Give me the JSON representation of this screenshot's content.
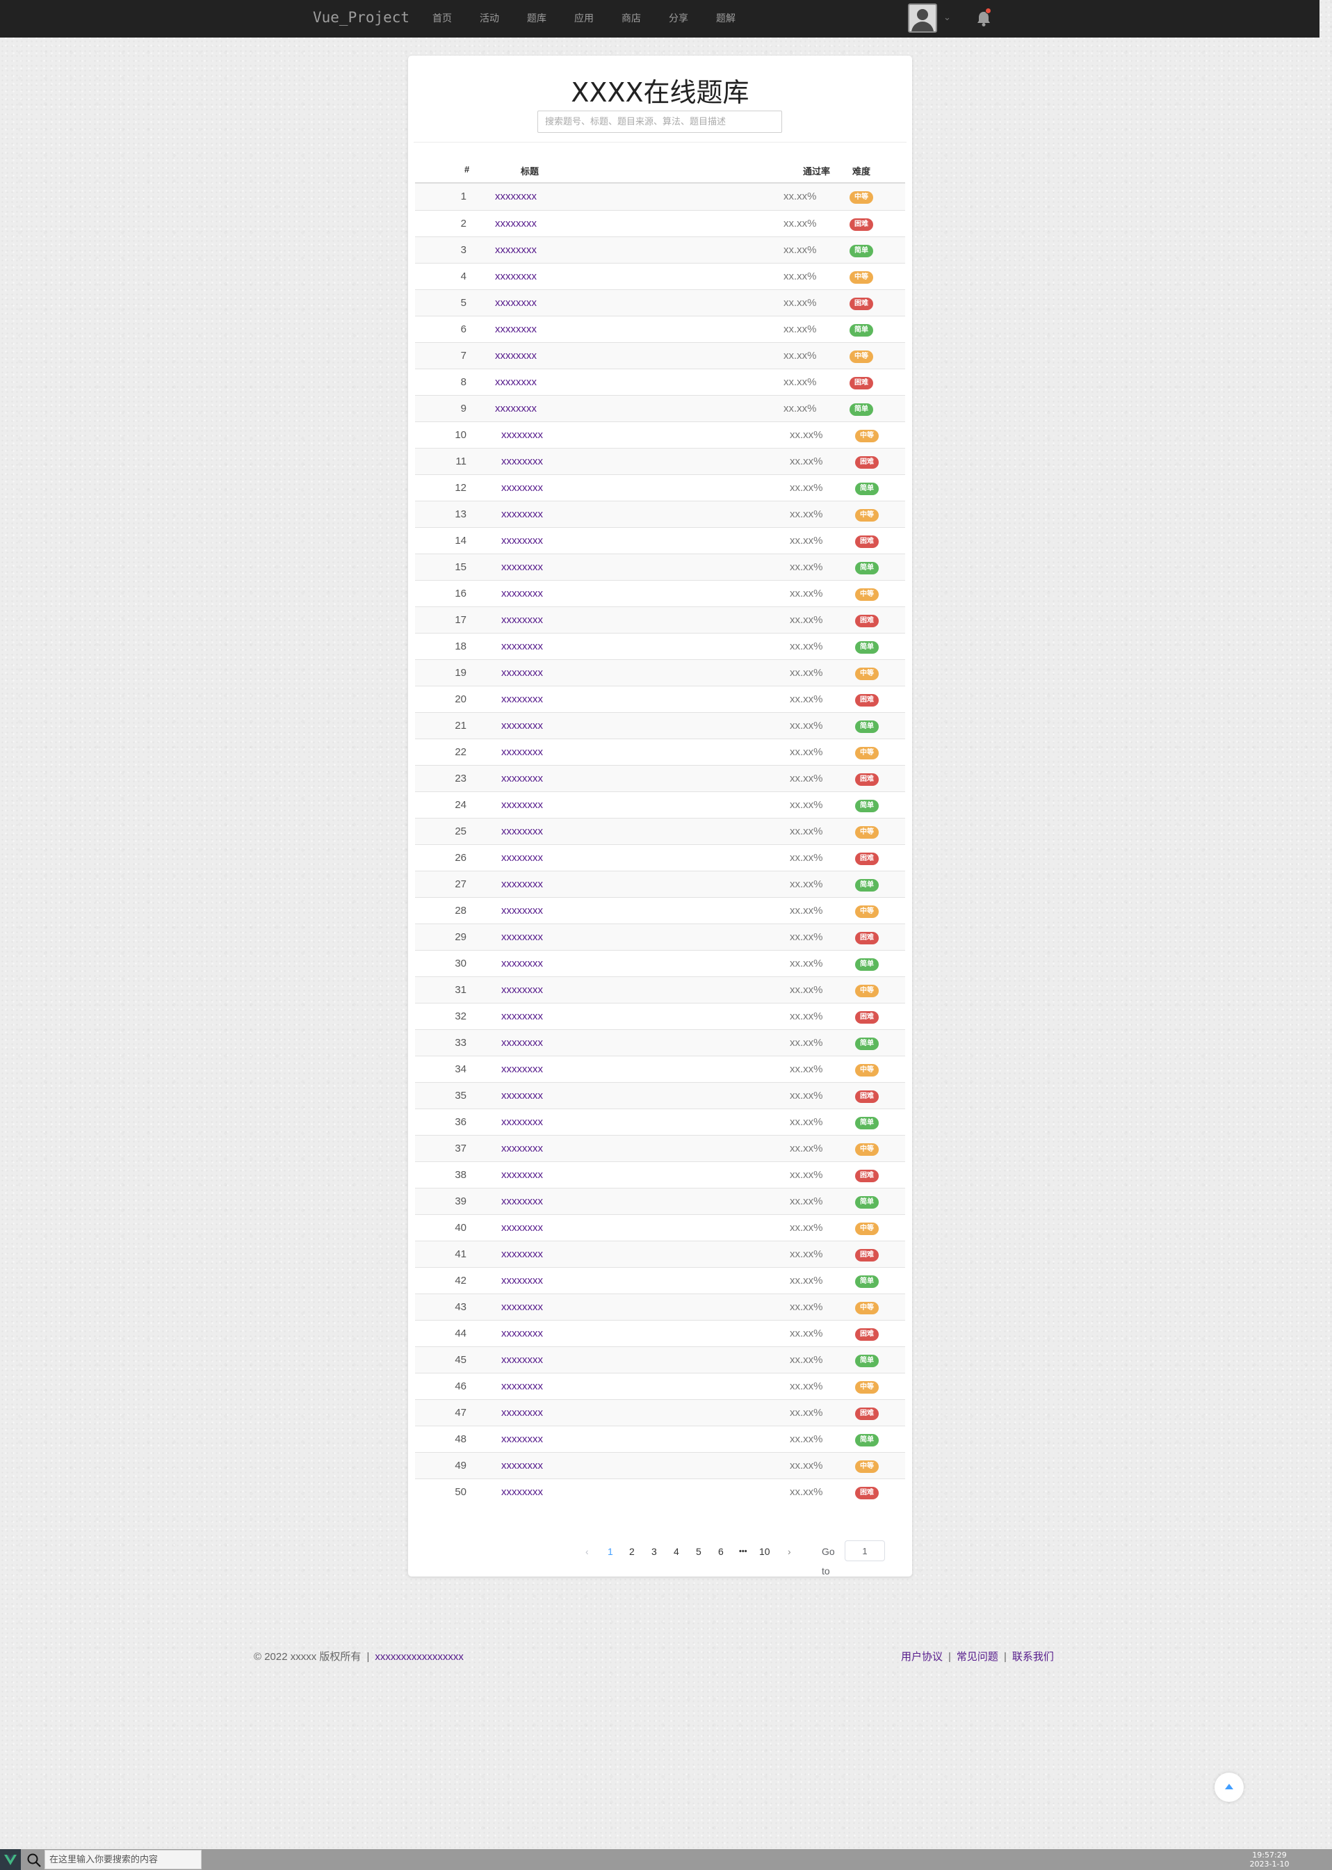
{
  "navbar": {
    "brand": "Vue_Project",
    "links": [
      "首页",
      "活动",
      "题库",
      "应用",
      "商店",
      "分享",
      "题解"
    ],
    "avatar_icon": "user-avatar-icon",
    "notification_icon": "bell-icon",
    "notification_dot_color": "#e9503f"
  },
  "main": {
    "title": "XXXX在线题库",
    "search_placeholder": "搜索题号、标题、题目来源、算法、题目描述",
    "columns": [
      "#",
      "标题",
      "通过率",
      "难度"
    ],
    "difficulty_labels": {
      "easy": "简单",
      "medium": "中等",
      "hard": "困难"
    },
    "difficulty_colors": {
      "easy": "#5cb85c",
      "medium": "#f0ad4e",
      "hard": "#d9534f"
    },
    "problems": [
      {
        "id": "1",
        "title": "xxxxxxxx",
        "rate": "xx.xx%",
        "difficulty": "medium"
      },
      {
        "id": "2",
        "title": "xxxxxxxx",
        "rate": "xx.xx%",
        "difficulty": "hard"
      },
      {
        "id": "3",
        "title": "xxxxxxxx",
        "rate": "xx.xx%",
        "difficulty": "easy"
      },
      {
        "id": "4",
        "title": "xxxxxxxx",
        "rate": "xx.xx%",
        "difficulty": "medium"
      },
      {
        "id": "5",
        "title": "xxxxxxxx",
        "rate": "xx.xx%",
        "difficulty": "hard"
      },
      {
        "id": "6",
        "title": "xxxxxxxx",
        "rate": "xx.xx%",
        "difficulty": "easy"
      },
      {
        "id": "7",
        "title": "xxxxxxxx",
        "rate": "xx.xx%",
        "difficulty": "medium"
      },
      {
        "id": "8",
        "title": "xxxxxxxx",
        "rate": "xx.xx%",
        "difficulty": "hard"
      },
      {
        "id": "9",
        "title": "xxxxxxxx",
        "rate": "xx.xx%",
        "difficulty": "easy"
      },
      {
        "id": "10",
        "title": "xxxxxxxx",
        "rate": "xx.xx%",
        "difficulty": "medium"
      },
      {
        "id": "11",
        "title": "xxxxxxxx",
        "rate": "xx.xx%",
        "difficulty": "hard"
      },
      {
        "id": "12",
        "title": "xxxxxxxx",
        "rate": "xx.xx%",
        "difficulty": "easy"
      },
      {
        "id": "13",
        "title": "xxxxxxxx",
        "rate": "xx.xx%",
        "difficulty": "medium"
      },
      {
        "id": "14",
        "title": "xxxxxxxx",
        "rate": "xx.xx%",
        "difficulty": "hard"
      },
      {
        "id": "15",
        "title": "xxxxxxxx",
        "rate": "xx.xx%",
        "difficulty": "easy"
      },
      {
        "id": "16",
        "title": "xxxxxxxx",
        "rate": "xx.xx%",
        "difficulty": "medium"
      },
      {
        "id": "17",
        "title": "xxxxxxxx",
        "rate": "xx.xx%",
        "difficulty": "hard"
      },
      {
        "id": "18",
        "title": "xxxxxxxx",
        "rate": "xx.xx%",
        "difficulty": "easy"
      },
      {
        "id": "19",
        "title": "xxxxxxxx",
        "rate": "xx.xx%",
        "difficulty": "medium"
      },
      {
        "id": "20",
        "title": "xxxxxxxx",
        "rate": "xx.xx%",
        "difficulty": "hard"
      },
      {
        "id": "21",
        "title": "xxxxxxxx",
        "rate": "xx.xx%",
        "difficulty": "easy"
      },
      {
        "id": "22",
        "title": "xxxxxxxx",
        "rate": "xx.xx%",
        "difficulty": "medium"
      },
      {
        "id": "23",
        "title": "xxxxxxxx",
        "rate": "xx.xx%",
        "difficulty": "hard"
      },
      {
        "id": "24",
        "title": "xxxxxxxx",
        "rate": "xx.xx%",
        "difficulty": "easy"
      },
      {
        "id": "25",
        "title": "xxxxxxxx",
        "rate": "xx.xx%",
        "difficulty": "medium"
      },
      {
        "id": "26",
        "title": "xxxxxxxx",
        "rate": "xx.xx%",
        "difficulty": "hard"
      },
      {
        "id": "27",
        "title": "xxxxxxxx",
        "rate": "xx.xx%",
        "difficulty": "easy"
      },
      {
        "id": "28",
        "title": "xxxxxxxx",
        "rate": "xx.xx%",
        "difficulty": "medium"
      },
      {
        "id": "29",
        "title": "xxxxxxxx",
        "rate": "xx.xx%",
        "difficulty": "hard"
      },
      {
        "id": "30",
        "title": "xxxxxxxx",
        "rate": "xx.xx%",
        "difficulty": "easy"
      },
      {
        "id": "31",
        "title": "xxxxxxxx",
        "rate": "xx.xx%",
        "difficulty": "medium"
      },
      {
        "id": "32",
        "title": "xxxxxxxx",
        "rate": "xx.xx%",
        "difficulty": "hard"
      },
      {
        "id": "33",
        "title": "xxxxxxxx",
        "rate": "xx.xx%",
        "difficulty": "easy"
      },
      {
        "id": "34",
        "title": "xxxxxxxx",
        "rate": "xx.xx%",
        "difficulty": "medium"
      },
      {
        "id": "35",
        "title": "xxxxxxxx",
        "rate": "xx.xx%",
        "difficulty": "hard"
      },
      {
        "id": "36",
        "title": "xxxxxxxx",
        "rate": "xx.xx%",
        "difficulty": "easy"
      },
      {
        "id": "37",
        "title": "xxxxxxxx",
        "rate": "xx.xx%",
        "difficulty": "medium"
      },
      {
        "id": "38",
        "title": "xxxxxxxx",
        "rate": "xx.xx%",
        "difficulty": "hard"
      },
      {
        "id": "39",
        "title": "xxxxxxxx",
        "rate": "xx.xx%",
        "difficulty": "easy"
      },
      {
        "id": "40",
        "title": "xxxxxxxx",
        "rate": "xx.xx%",
        "difficulty": "medium"
      },
      {
        "id": "41",
        "title": "xxxxxxxx",
        "rate": "xx.xx%",
        "difficulty": "hard"
      },
      {
        "id": "42",
        "title": "xxxxxxxx",
        "rate": "xx.xx%",
        "difficulty": "easy"
      },
      {
        "id": "43",
        "title": "xxxxxxxx",
        "rate": "xx.xx%",
        "difficulty": "medium"
      },
      {
        "id": "44",
        "title": "xxxxxxxx",
        "rate": "xx.xx%",
        "difficulty": "hard"
      },
      {
        "id": "45",
        "title": "xxxxxxxx",
        "rate": "xx.xx%",
        "difficulty": "easy"
      },
      {
        "id": "46",
        "title": "xxxxxxxx",
        "rate": "xx.xx%",
        "difficulty": "medium"
      },
      {
        "id": "47",
        "title": "xxxxxxxx",
        "rate": "xx.xx%",
        "difficulty": "hard"
      },
      {
        "id": "48",
        "title": "xxxxxxxx",
        "rate": "xx.xx%",
        "difficulty": "easy"
      },
      {
        "id": "49",
        "title": "xxxxxxxx",
        "rate": "xx.xx%",
        "difficulty": "medium"
      },
      {
        "id": "50",
        "title": "xxxxxxxx",
        "rate": "xx.xx%",
        "difficulty": "hard"
      }
    ]
  },
  "pagination": {
    "prev_icon": "chevron-left-icon",
    "next_icon": "chevron-right-icon",
    "pages": [
      "1",
      "2",
      "3",
      "4",
      "5",
      "6",
      "10"
    ],
    "ellipsis": "•••",
    "current": "1",
    "goto_label": "Go to",
    "goto_value": "1",
    "active_color": "#409eff"
  },
  "footer": {
    "copyright": "© 2022 xxxxx 版权所有",
    "separator": "|",
    "record_link": "xxxxxxxxxxxxxxxxx",
    "links": [
      "用户协议",
      "常见问题",
      "联系我们"
    ]
  },
  "back_to_top_icon": "arrow-up-icon",
  "taskbar": {
    "logo_icon": "vue-logo-icon",
    "search_icon": "search-icon",
    "search_placeholder": "在这里输入你要搜索的内容",
    "time": "19:57:29",
    "date": "2023-1-10"
  }
}
